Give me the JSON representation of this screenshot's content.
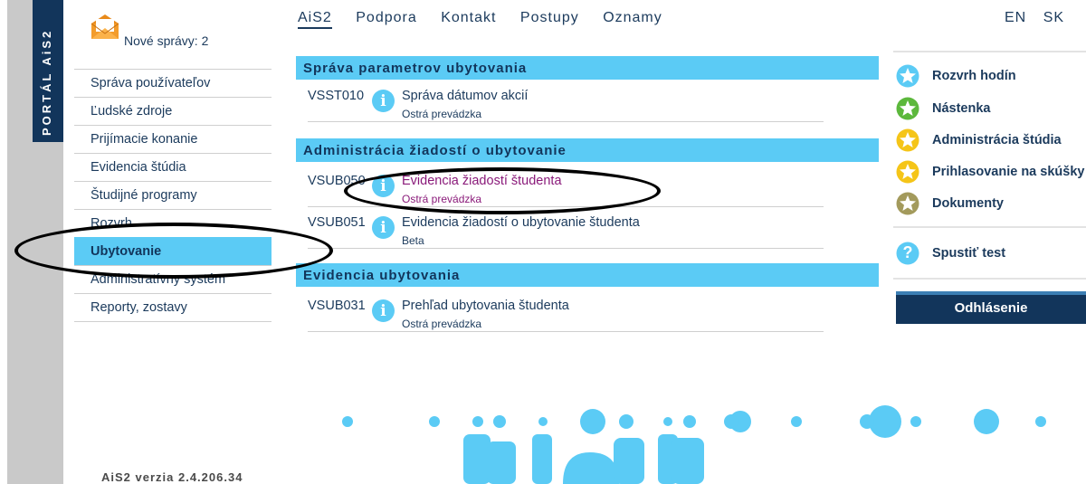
{
  "sidebar": {
    "portal_label": "PORTÁL AiS2",
    "messages": "Nové správy: 2",
    "items": [
      {
        "label": "Správa používateľov"
      },
      {
        "label": "Ľudské zdroje"
      },
      {
        "label": "Prijímacie konanie"
      },
      {
        "label": "Evidencia štúdia"
      },
      {
        "label": "Študijné programy"
      },
      {
        "label": "Rozvrh"
      },
      {
        "label": "Ubytovanie"
      },
      {
        "label": "Administratívny systém"
      },
      {
        "label": "Reporty, zostavy"
      }
    ],
    "active_item": "Ubytovanie",
    "version": "AiS2 verzia 2.4.206.34"
  },
  "topnav": {
    "items": [
      "AiS2",
      "Podpora",
      "Kontakt",
      "Postupy",
      "Oznamy"
    ],
    "active": "AiS2",
    "languages": [
      "EN",
      "SK"
    ]
  },
  "sections": [
    {
      "title": "Správa parametrov ubytovania",
      "entries": [
        {
          "code": "VSST010",
          "title": "Správa dátumov akcií",
          "status": "Ostrá prevádzka",
          "visited": false
        }
      ]
    },
    {
      "title": "Administrácia žiadostí o ubytovanie",
      "entries": [
        {
          "code": "VSUB050",
          "title": "Evidencia žiadostí študenta",
          "status": "Ostrá prevádzka",
          "visited": true
        },
        {
          "code": "VSUB051",
          "title": "Evidencia žiadostí o ubytovanie študenta",
          "status": "Beta",
          "visited": false
        }
      ]
    },
    {
      "title": "Evidencia ubytovania",
      "entries": [
        {
          "code": "VSUB031",
          "title": "Prehľad ubytovania študenta",
          "status": "Ostrá prevádzka",
          "visited": false
        }
      ]
    }
  ],
  "right_links": [
    {
      "label": "Rozvrh hodín",
      "icon": "star-blue-icon",
      "color": "#5bcbf5"
    },
    {
      "label": "Nástenka",
      "icon": "star-green-icon",
      "color": "#5cb83c"
    },
    {
      "label": "Administrácia štúdia",
      "icon": "star-yellow-icon",
      "color": "#f5c518"
    },
    {
      "label": "Prihlasovanie na skúšky",
      "icon": "star-yellow-icon",
      "color": "#f5c518"
    },
    {
      "label": "Dokumenty",
      "icon": "star-olive-icon",
      "color": "#a39a5c"
    }
  ],
  "test_link": {
    "label": "Spustiť test",
    "icon": "help-icon"
  },
  "logout_label": "Odhlásenie",
  "info_glyph": "i",
  "help_glyph": "?",
  "colors": {
    "accent": "#5bcbf5",
    "navy": "#12355b",
    "visited": "#8a1a7a"
  }
}
